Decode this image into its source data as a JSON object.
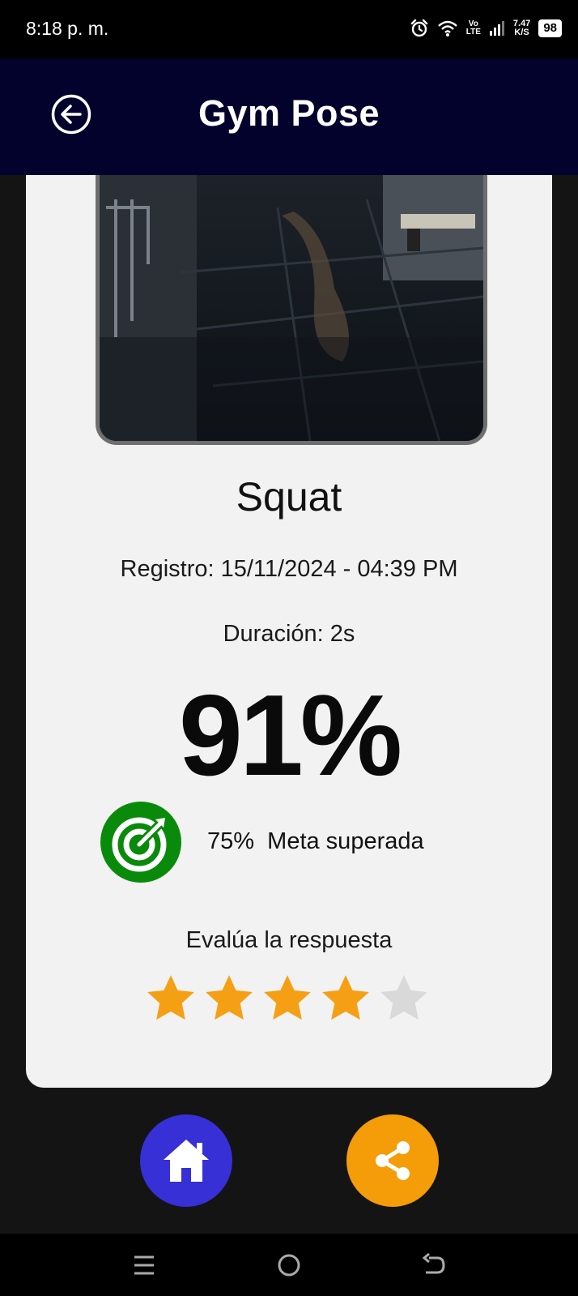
{
  "status_bar": {
    "time": "8:18 p. m.",
    "net_speed": "7.47",
    "net_speed_unit": "K/S",
    "volte_top": "Vo",
    "volte_bottom": "LTE",
    "battery": "98",
    "icons": [
      "alarm-icon",
      "wifi-icon",
      "volte-icon",
      "signal-icon",
      "battery-icon"
    ]
  },
  "header": {
    "title": "Gym Pose",
    "back_icon": "back-arrow-icon",
    "background": "#02022c"
  },
  "result": {
    "exercise": "Squat",
    "registro": "Registro: 15/11/2024 - 04:39 PM",
    "duracion": "Duración: 2s",
    "score": "91%",
    "goal_text": "75%  Meta superada",
    "goal_icon": "target-goal-icon",
    "goal_color": "#0a8a0a"
  },
  "rating": {
    "label": "Evalúa la respuesta",
    "value": 4,
    "max": 5,
    "filled_color": "#f5a014",
    "empty_color": "#d9d9d9"
  },
  "actions": {
    "home_icon": "home-icon",
    "home_color": "#3630d6",
    "share_icon": "share-icon",
    "share_color": "#f59c09"
  },
  "nav": {
    "icons": [
      "menu-icon",
      "home-circle-icon",
      "back-icon"
    ]
  }
}
